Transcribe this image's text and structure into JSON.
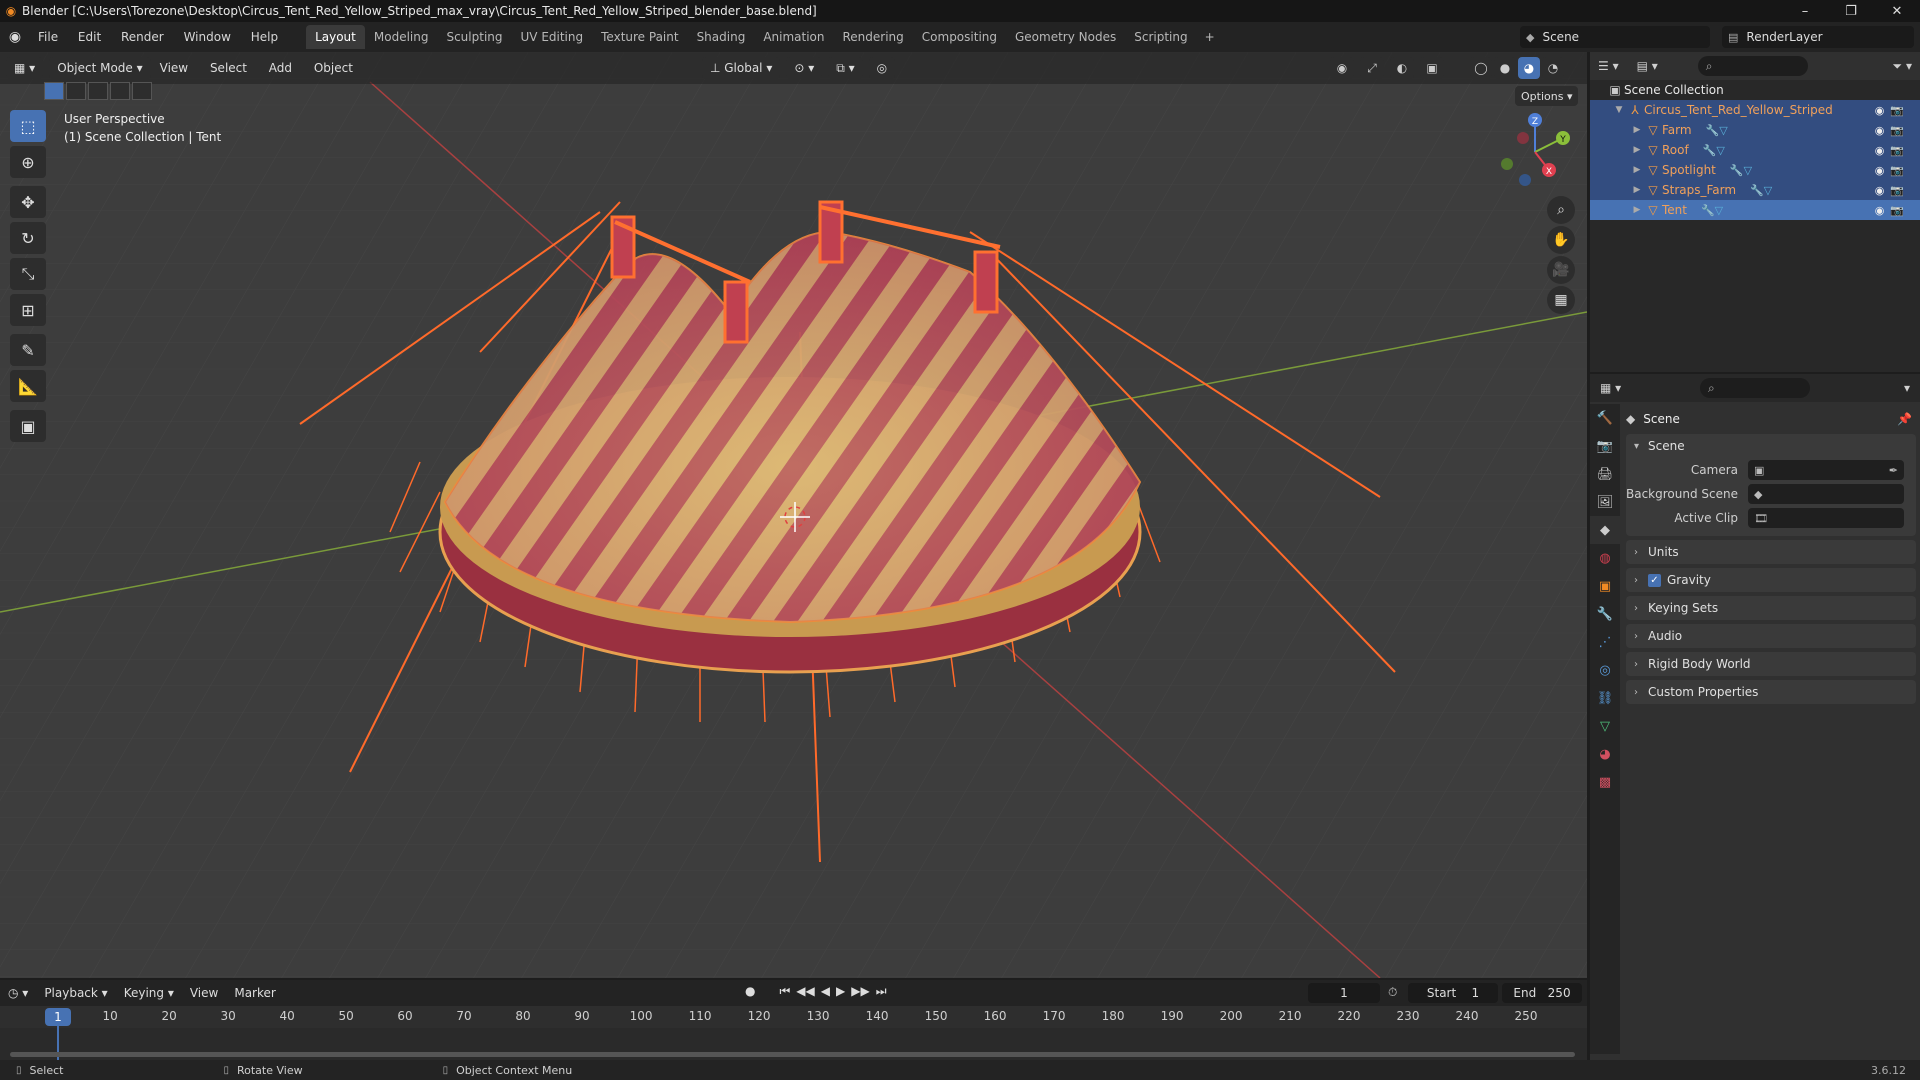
{
  "window": {
    "title": "Blender [C:\\Users\\Torezone\\Desktop\\Circus_Tent_Red_Yellow_Striped_max_vray\\Circus_Tent_Red_Yellow_Striped_blender_base.blend]",
    "minimize": "–",
    "maximize": "❐",
    "close": "✕"
  },
  "menu": [
    "File",
    "Edit",
    "Render",
    "Window",
    "Help"
  ],
  "workspaces": [
    "Layout",
    "Modeling",
    "Sculpting",
    "UV Editing",
    "Texture Paint",
    "Shading",
    "Animation",
    "Rendering",
    "Compositing",
    "Geometry Nodes",
    "Scripting"
  ],
  "active_workspace": "Layout",
  "scene_name": "Scene",
  "render_layer": "RenderLayer",
  "viewport": {
    "mode": "Object Mode",
    "menu": [
      "View",
      "Select",
      "Add",
      "Object"
    ],
    "orientation": "Global",
    "info_line1": "User Perspective",
    "info_line2": "(1) Scene Collection | Tent",
    "options_label": "Options",
    "gizmo": {
      "x": "X",
      "y": "Y",
      "z": "Z"
    }
  },
  "outliner": {
    "root": "Scene Collection",
    "collection": "Circus_Tent_Red_Yellow_Striped",
    "objects": [
      "Farm",
      "Roof",
      "Spotlight",
      "Straps_Farm",
      "Tent"
    ]
  },
  "properties": {
    "title": "Scene",
    "panel": "Scene",
    "fields": [
      {
        "label": "Camera",
        "value": ""
      },
      {
        "label": "Background Scene",
        "value": ""
      },
      {
        "label": "Active Clip",
        "value": ""
      }
    ],
    "sections": [
      "Units",
      "Gravity",
      "Keying Sets",
      "Audio",
      "Rigid Body World",
      "Custom Properties"
    ]
  },
  "timeline": {
    "menu": [
      "Playback",
      "Keying",
      "View",
      "Marker"
    ],
    "current_frame": "1",
    "start_label": "Start",
    "start": "1",
    "end_label": "End",
    "end": "250",
    "ticks": [
      "1",
      "10",
      "20",
      "30",
      "40",
      "50",
      "60",
      "70",
      "80",
      "90",
      "100",
      "110",
      "120",
      "130",
      "140",
      "150",
      "160",
      "170",
      "180",
      "190",
      "200",
      "210",
      "220",
      "230",
      "240",
      "250"
    ]
  },
  "statusbar": {
    "select": "Select",
    "rotate": "Rotate View",
    "context": "Object Context Menu",
    "version": "3.6.12"
  },
  "colors": {
    "accent": "#4772b3",
    "selected_object": "#f0a05a",
    "tent_red": "#a8344a",
    "tent_yellow": "#d8b468",
    "rope": "#ff6a2a"
  }
}
